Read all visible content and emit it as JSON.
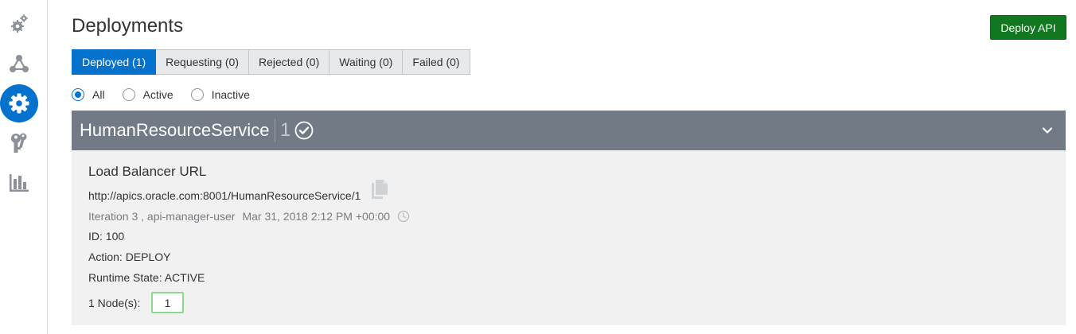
{
  "sidebar": {
    "items": [
      {
        "icon": "settings-small-icon"
      },
      {
        "icon": "network-icon"
      },
      {
        "icon": "gear-icon",
        "active": true
      },
      {
        "icon": "keys-icon"
      },
      {
        "icon": "bar-chart-icon"
      }
    ]
  },
  "header": {
    "title": "Deployments",
    "deploy_button": "Deploy API"
  },
  "tabs": [
    {
      "label": "Deployed (1)",
      "active": true
    },
    {
      "label": "Requesting (0)"
    },
    {
      "label": "Rejected (0)"
    },
    {
      "label": "Waiting (0)"
    },
    {
      "label": "Failed (0)"
    }
  ],
  "filters": {
    "selected": "All",
    "options": [
      {
        "label": "All"
      },
      {
        "label": "Active"
      },
      {
        "label": "Inactive"
      }
    ]
  },
  "service": {
    "name": "HumanResourceService",
    "count": "1",
    "load_balancer_title": "Load Balancer URL",
    "url": "http://apics.oracle.com:8001/HumanResourceService/1",
    "iteration": "Iteration 3 , api-manager-user",
    "timestamp": "Mar 31, 2018 2:12 PM +00:00",
    "id_line": "ID: 100",
    "action_line": "Action: DEPLOY",
    "runtime_line": "Runtime State: ACTIVE",
    "nodes_label": "1 Node(s):",
    "nodes_value": "1"
  },
  "colors": {
    "accent": "#0572ce",
    "deploy_button": "#11781f",
    "service_header": "#717a85",
    "panel_bg": "#f1f1f1"
  }
}
